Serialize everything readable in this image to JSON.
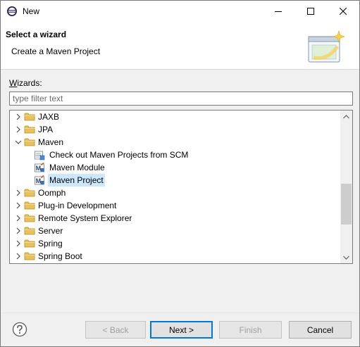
{
  "window": {
    "title": "New"
  },
  "header": {
    "title": "Select a wizard",
    "description": "Create a Maven Project"
  },
  "wizards_label": "Wizards:",
  "filter": {
    "placeholder": "type filter text",
    "value": ""
  },
  "tree": {
    "items": [
      {
        "label": "JAXB",
        "level": 0,
        "expanded": false,
        "type": "folder"
      },
      {
        "label": "JPA",
        "level": 0,
        "expanded": false,
        "type": "folder"
      },
      {
        "label": "Maven",
        "level": 0,
        "expanded": true,
        "type": "folder"
      },
      {
        "label": "Check out Maven Projects from SCM",
        "level": 1,
        "type": "scm"
      },
      {
        "label": "Maven Module",
        "level": 1,
        "type": "maven"
      },
      {
        "label": "Maven Project",
        "level": 1,
        "type": "maven",
        "selected": true
      },
      {
        "label": "Oomph",
        "level": 0,
        "expanded": false,
        "type": "folder"
      },
      {
        "label": "Plug-in Development",
        "level": 0,
        "expanded": false,
        "type": "folder"
      },
      {
        "label": "Remote System Explorer",
        "level": 0,
        "expanded": false,
        "type": "folder"
      },
      {
        "label": "Server",
        "level": 0,
        "expanded": false,
        "type": "folder"
      },
      {
        "label": "Spring",
        "level": 0,
        "expanded": false,
        "type": "folder"
      },
      {
        "label": "Spring Boot",
        "level": 0,
        "expanded": false,
        "type": "folder"
      }
    ]
  },
  "buttons": {
    "back": "< Back",
    "next": "Next >",
    "finish": "Finish",
    "cancel": "Cancel"
  },
  "colors": {
    "selection": "#cce8ff",
    "folder": "#e8c15a",
    "default_button_border": "#0078d7"
  }
}
